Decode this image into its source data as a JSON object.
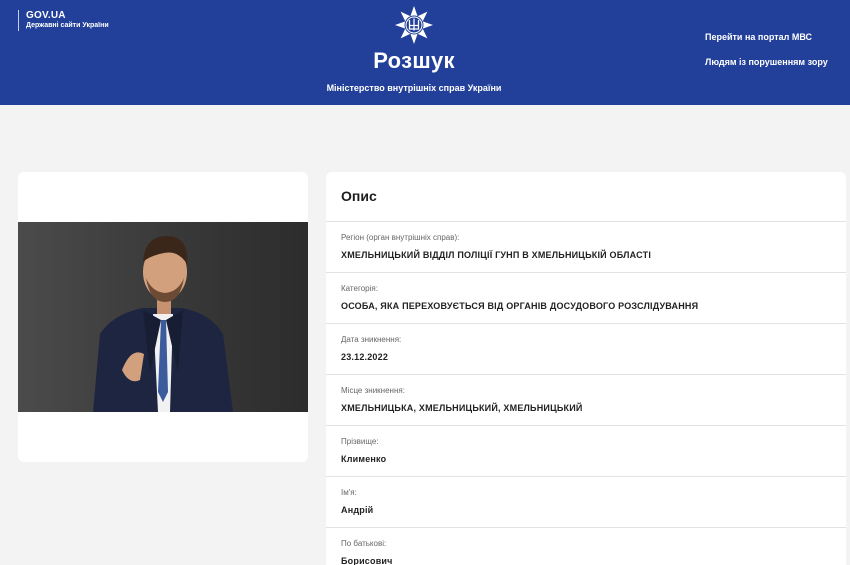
{
  "header": {
    "gov_title": "GOV.UA",
    "gov_subtitle": "Державні сайти України",
    "title": "Розшук",
    "subtitle": "Міністерство внутрішніх справ України",
    "links": [
      "Перейти на портал МВС",
      "Людям із порушенням зору"
    ],
    "emblem_icon": "police-star-trident-icon",
    "bg_color": "#22409a"
  },
  "description": {
    "title": "Опис",
    "fields": [
      {
        "label": "Регіон (орган внутрішніх справ):",
        "value": "ХМЕЛЬНИЦЬКИЙ ВІДДІЛ ПОЛІЦІЇ ГУНП В ХМЕЛЬНИЦЬКІЙ ОБЛАСТІ"
      },
      {
        "label": "Категорія:",
        "value": "ОСОБА, ЯКА ПЕРЕХОВУЄТЬСЯ ВІД ОРГАНІВ ДОСУДОВОГО РОЗСЛІДУВАННЯ"
      },
      {
        "label": "Дата зникнення:",
        "value": "23.12.2022"
      },
      {
        "label": "Місце зникнення:",
        "value": "ХМЕЛЬНИЦЬКА, ХМЕЛЬНИЦЬКИЙ, ХМЕЛЬНИЦЬКИЙ"
      },
      {
        "label": "Прізвище:",
        "value": "Клименко"
      },
      {
        "label": "Ім'я:",
        "value": "Андрій"
      },
      {
        "label": "По батькові:",
        "value": "Борисович"
      }
    ]
  }
}
